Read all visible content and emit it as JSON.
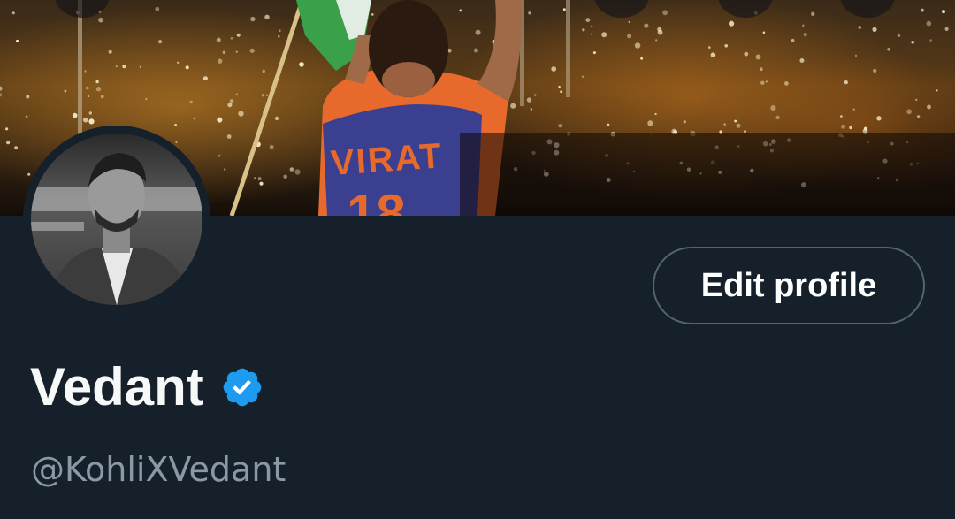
{
  "profile": {
    "display_name": "Vedant",
    "handle": "@KohliXVedant",
    "verified": true,
    "edit_button_label": "Edit profile"
  },
  "banner": {
    "jersey_name": "VIRAT",
    "jersey_number": "18"
  },
  "colors": {
    "background": "#15202b",
    "verified_badge": "#1d9bf0",
    "handle_text": "#8b98a5",
    "button_border": "#536471",
    "jersey_orange": "#e8692c",
    "jersey_blue": "#3a3f8f"
  },
  "icons": {
    "verified": "verified-badge-icon"
  }
}
